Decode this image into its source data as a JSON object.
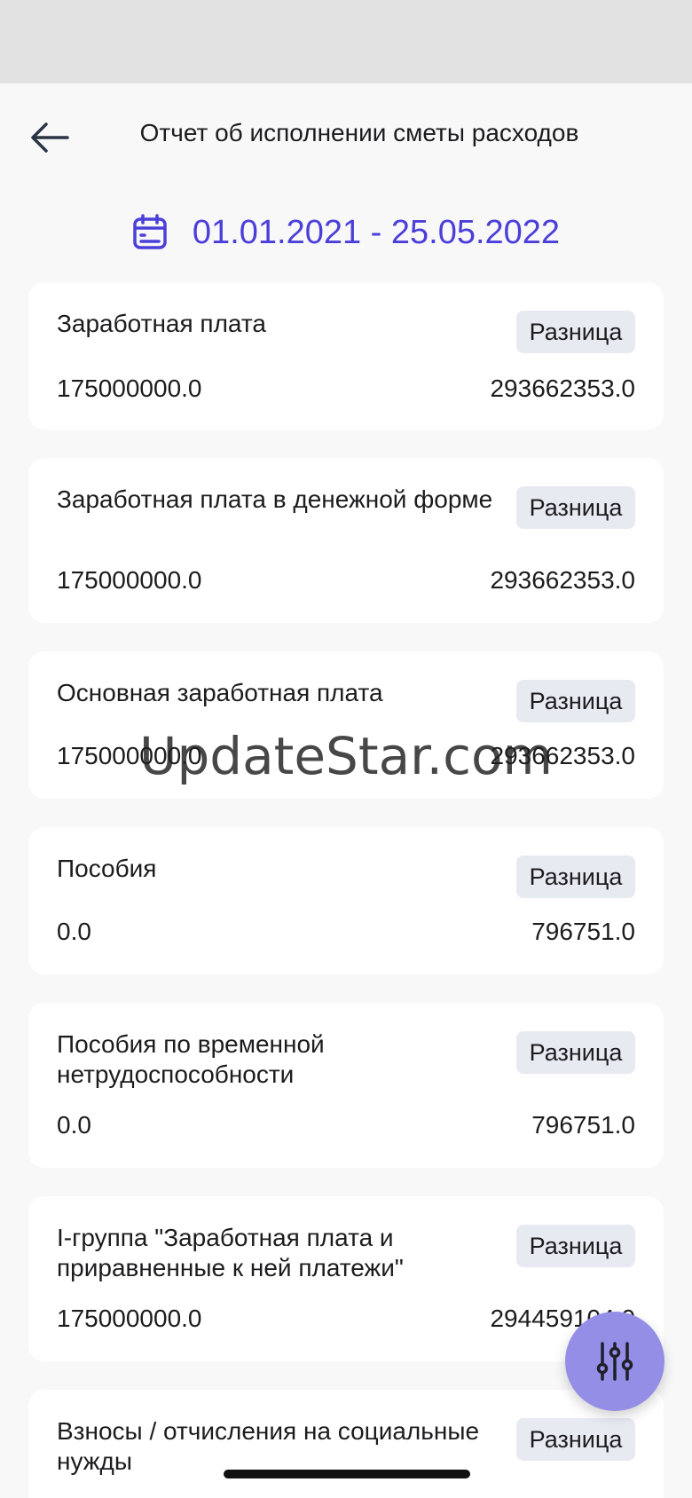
{
  "header": {
    "title": "Отчет об исполнении сметы расходов"
  },
  "period": {
    "range": "01.01.2021 - 25.05.2022"
  },
  "diff_label": "Разница",
  "items": [
    {
      "name": "Заработная плата",
      "plan": "175000000.0",
      "fact": "293662353.0"
    },
    {
      "name": "Заработная плата в денежной форме",
      "plan": "175000000.0",
      "fact": "293662353.0"
    },
    {
      "name": "Основная заработная плата",
      "plan": "175000000.0",
      "fact": "293662353.0"
    },
    {
      "name": "Пособия",
      "plan": "0.0",
      "fact": "796751.0"
    },
    {
      "name": "Пособия по временной нетрудоспособности",
      "plan": "0.0",
      "fact": "796751.0"
    },
    {
      "name": "I-группа \"Заработная плата и приравненные к ней платежи\"",
      "plan": "175000000.0",
      "fact": "294459104.0"
    },
    {
      "name": "Взносы / отчисления на социальные нужды",
      "plan": "",
      "fact": ""
    }
  ],
  "watermark": "UpdateStar.com",
  "colors": {
    "accent": "#4b3fd9",
    "fab": "#958ee6",
    "badge_bg": "#e8eaf2"
  }
}
